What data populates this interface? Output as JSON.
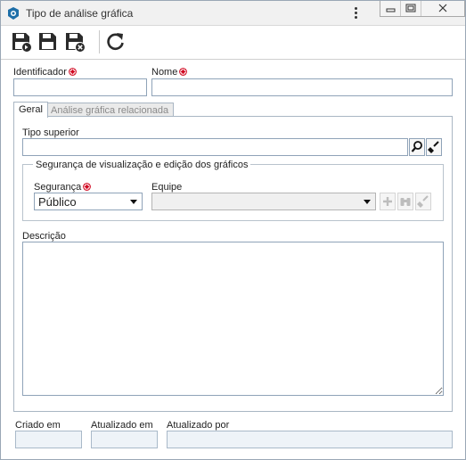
{
  "window": {
    "title": "Tipo de análise gráfica",
    "menu_icon": "kebab-menu-icon",
    "controls": [
      "minimize-icon",
      "restore-icon",
      "close-icon"
    ]
  },
  "toolbar": {
    "buttons": [
      {
        "name": "save-and-new",
        "icon": "save-new-icon"
      },
      {
        "name": "save",
        "icon": "save-icon"
      },
      {
        "name": "save-and-close",
        "icon": "save-close-icon"
      },
      {
        "name": "refresh",
        "icon": "refresh-icon"
      }
    ]
  },
  "form": {
    "identificador_label": "Identificador",
    "identificador_value": "",
    "nome_label": "Nome",
    "nome_value": ""
  },
  "tabs": [
    {
      "label": "Geral",
      "active": true
    },
    {
      "label": "Análise gráfica relacionada",
      "active": false
    }
  ],
  "geral": {
    "tipo_superior_label": "Tipo superior",
    "tipo_superior_value": "",
    "security_group_legend": "Segurança de visualização e edição dos gráficos",
    "seguranca_label": "Segurança",
    "seguranca_value": "Público",
    "equipe_label": "Equipe",
    "equipe_value": "",
    "descricao_label": "Descrição",
    "descricao_value": ""
  },
  "footer": {
    "criado_em_label": "Criado em",
    "criado_em_value": "",
    "atualizado_em_label": "Atualizado em",
    "atualizado_em_value": "",
    "atualizado_por_label": "Atualizado por",
    "atualizado_por_value": ""
  },
  "colors": {
    "required": "#d0021b",
    "app_icon": "#1e6fa8",
    "field_border": "#8fa3b8"
  }
}
